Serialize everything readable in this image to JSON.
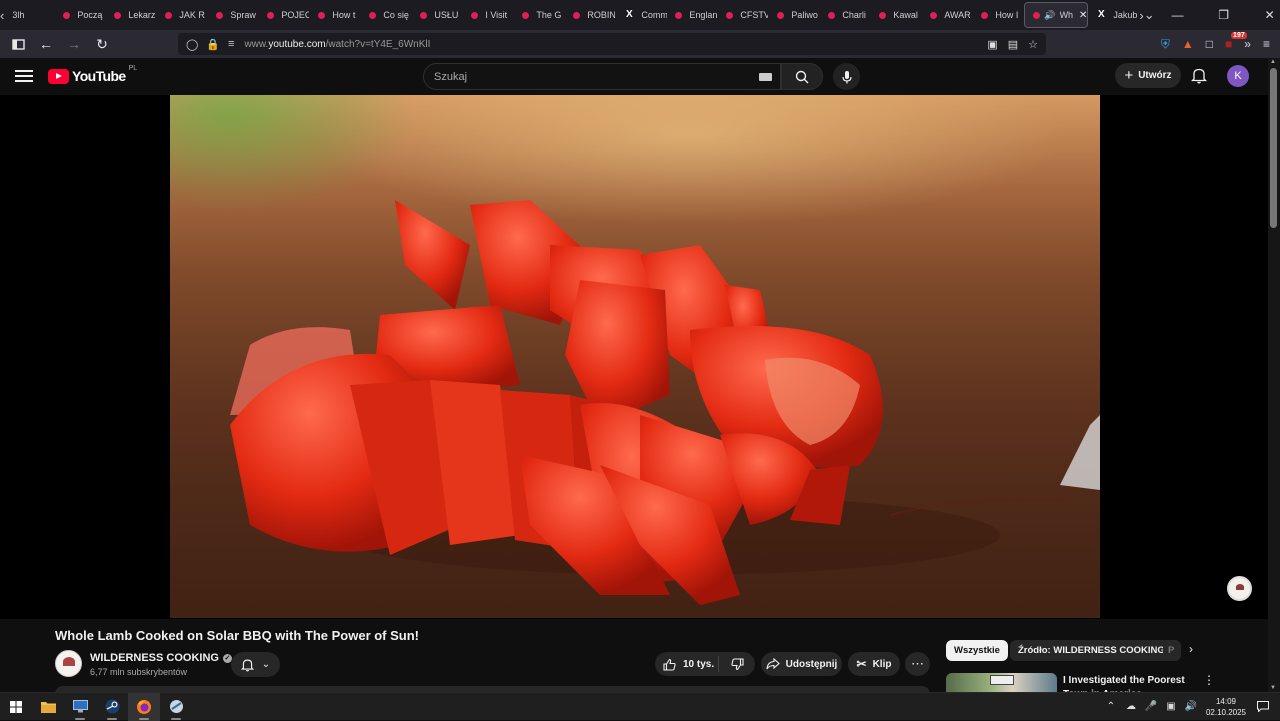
{
  "browser": {
    "tabs": [
      {
        "title": "3lh",
        "icon": "generic"
      },
      {
        "title": "Począ",
        "icon": "youtube"
      },
      {
        "title": "Lekarz",
        "icon": "youtube"
      },
      {
        "title": "JAK R",
        "icon": "youtube"
      },
      {
        "title": "Spraw",
        "icon": "youtube"
      },
      {
        "title": "POJEC",
        "icon": "youtube"
      },
      {
        "title": "How t",
        "icon": "youtube"
      },
      {
        "title": "Co się",
        "icon": "youtube"
      },
      {
        "title": "USŁU",
        "icon": "youtube"
      },
      {
        "title": "I Visit",
        "icon": "youtube"
      },
      {
        "title": "The G",
        "icon": "youtube"
      },
      {
        "title": "ROBIN",
        "icon": "youtube"
      },
      {
        "title": "Comm",
        "icon": "x"
      },
      {
        "title": "Englan",
        "icon": "youtube"
      },
      {
        "title": "CFSTV",
        "icon": "youtube"
      },
      {
        "title": "Paliwo",
        "icon": "youtube"
      },
      {
        "title": "Charli",
        "icon": "youtube"
      },
      {
        "title": "Kawal",
        "icon": "youtube"
      },
      {
        "title": "AWAR",
        "icon": "youtube"
      },
      {
        "title": "How I",
        "icon": "youtube"
      },
      {
        "title": "Wh",
        "icon": "youtube",
        "active": true
      },
      {
        "title": "Jakub",
        "icon": "x"
      }
    ],
    "url_prefix": "www.",
    "url_domain": "youtube.com",
    "url_path": "/watch?v=tY4E_6WnKlI",
    "extension_badge": "197"
  },
  "youtube": {
    "logo_text": "YouTube",
    "country_code": "PL",
    "search_placeholder": "Szukaj",
    "create_label": "Utwórz",
    "avatar_letter": "K",
    "avatar_color": "#7e57c2",
    "accent": "#ff0033"
  },
  "video": {
    "title": "Whole Lamb Cooked on Solar BBQ with The Power of Sun!",
    "channel_name": "WILDERNESS COOKING",
    "subscribers": "6,77 mln subskrybentów",
    "likes": "10 tys.",
    "share_label": "Udostępnij",
    "clip_label": "Klip"
  },
  "sidebar": {
    "chips": [
      "Wszystkie",
      "Źródło: WILDERNESS COOKING",
      "P"
    ],
    "recommended": [
      {
        "title": "I Investigated the Poorest Town in America"
      }
    ]
  },
  "taskbar": {
    "time": "14:09",
    "date": "02.10.2025",
    "apps": [
      "start",
      "file-explorer",
      "remote-desktop",
      "steam",
      "firefox",
      "app"
    ]
  }
}
